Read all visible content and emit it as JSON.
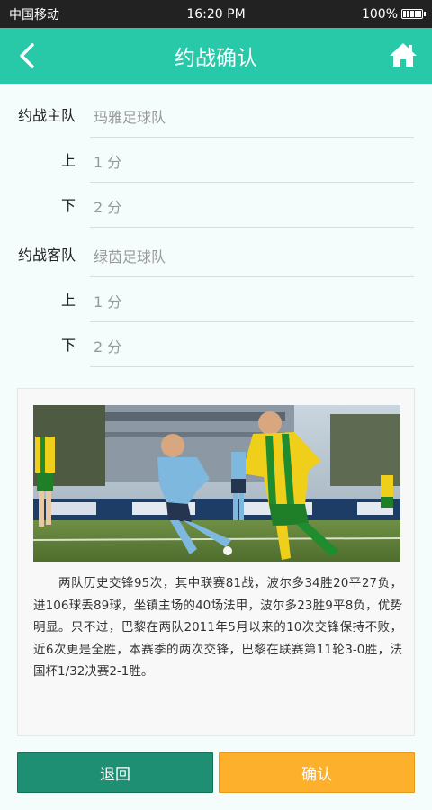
{
  "status_bar": {
    "carrier": "中国移动",
    "time": "16:20 PM",
    "battery": "100%"
  },
  "header": {
    "title": "约战确认",
    "back_icon": "chevron-left-icon",
    "home_icon": "home-icon"
  },
  "home_team": {
    "label": "约战主队",
    "name": "玛雅足球队",
    "first_half_label": "上",
    "first_half_score": "1 分",
    "second_half_label": "下",
    "second_half_score": "2 分"
  },
  "away_team": {
    "label": "约战客队",
    "name": "绿茵足球队",
    "first_half_label": "上",
    "first_half_score": "1 分",
    "second_half_label": "下",
    "second_half_score": "2 分"
  },
  "article": {
    "text": "两队历史交锋95次，其中联赛81战，波尔多34胜20平27负，进106球丢89球，坐镇主场的40场法甲，波尔多23胜9平8负，优势明显。只不过，巴黎在两队2011年5月以来的10次交锋保持不败，近6次更是全胜，本赛季的两次交锋，巴黎在联赛第11轮3-0胜，法国杯1/32决赛2-1胜。"
  },
  "buttons": {
    "back": "退回",
    "confirm": "确认"
  },
  "colors": {
    "accent": "#27c9a9",
    "back_button": "#1f8f74",
    "confirm_button": "#fdb02b"
  }
}
